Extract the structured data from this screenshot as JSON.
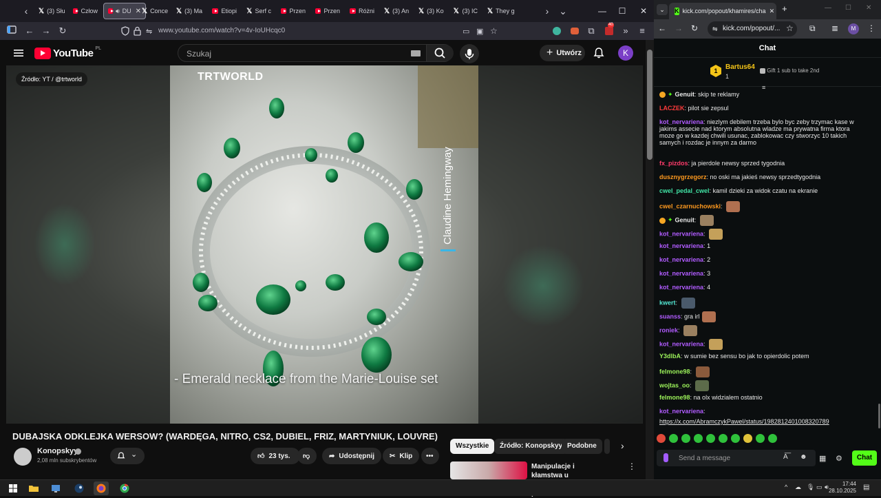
{
  "firefox": {
    "tabs": [
      {
        "label": "(3) Słu",
        "icon": "x-icon"
      },
      {
        "label": "Człow",
        "icon": "youtube-icon"
      },
      {
        "label": "DU",
        "icon": "youtube-icon",
        "active": true
      },
      {
        "label": "Conce",
        "icon": "x-icon"
      },
      {
        "label": "(3) Ma",
        "icon": "x-icon"
      },
      {
        "label": "Etiopi",
        "icon": "youtube-icon"
      },
      {
        "label": "Serf c",
        "icon": "x-icon"
      },
      {
        "label": "Przen",
        "icon": "youtube-icon"
      },
      {
        "label": "Przen",
        "icon": "youtube-icon"
      },
      {
        "label": "Różni",
        "icon": "youtube-icon"
      },
      {
        "label": "(3) An",
        "icon": "x-icon"
      },
      {
        "label": "(3) Ko",
        "icon": "x-icon"
      },
      {
        "label": "(3) IC",
        "icon": "x-icon"
      },
      {
        "label": "They g",
        "icon": "x-icon"
      }
    ],
    "url": "www.youtube.com/watch?v=4v-IoUHcqc0",
    "badge_count": "40"
  },
  "youtube": {
    "logo_text": "YouTube",
    "country": "PL",
    "search_placeholder": "Szukaj",
    "create_label": "Utwórz",
    "avatar_letter": "K",
    "video": {
      "source_badge": "Źródło: YT / @trtworld",
      "trt_logo": "TRTWORLD",
      "caption": "- Emerald necklace from the Marie-Louise set",
      "vertical_name": "Claudine Hemingway"
    },
    "title": "DUBAJSKA ODKLEJKA WERSOW? (WARDĘGA, NITRO, CS2, DUBIEL, FRIZ, MARTYNIUK, LOUVRE)",
    "channel": {
      "name": "Konopskyy",
      "subs": "2,08 mln subskrybentów"
    },
    "actions": {
      "likes": "23 tys.",
      "share": "Udostępnij",
      "clip": "Klip"
    },
    "chips": [
      "Wszystkie",
      "Źródło: Konopskyy",
      "Podobne"
    ],
    "recommendation": {
      "title": "Manipulacje i kłamstwa u Rymanowskiego, połowa"
    }
  },
  "chrome": {
    "tab_title": "kick.com/popout/khamires/cha",
    "omnibox": "kick.com/popout/...",
    "profile_letter": "M"
  },
  "chat": {
    "header": "Chat",
    "pinned": {
      "rank": "1",
      "user": "Bartus64",
      "count": "1",
      "gift_text": "Gift 1 sub to take 2nd"
    },
    "messages": [
      {
        "user": "Genuit",
        "color": "#e8e8e8",
        "text": "skip te reklamy",
        "badge": true
      },
      {
        "user": "LACZEK",
        "color": "#ff3b3b",
        "text": "pilot sie zepsul"
      },
      {
        "user": "kot_nervariena",
        "color": "#b15cff",
        "text": "niezlym debilem trzeba bylo byc zeby trzymac kase w jakims assecie nad ktorym absolutna wladze ma prywatna firma ktora moze go w kazdej chwili usunac, zablokowac czy stworzyc 10 takich samych i rozdac je innym za darmo"
      },
      {
        "user": "fx_pizdos",
        "color": "#ff3b6b",
        "text": "ja pierdole newsy sprzed tygodnia"
      },
      {
        "user": "dusznygrzegorz",
        "color": "#ff9a1f",
        "text": "no oski ma jakieś newsy sprzedtygodnia"
      },
      {
        "user": "cwel_pedal_cwel",
        "color": "#41e3a5",
        "text": "kamil dzieki za widok czatu na ekranie"
      },
      {
        "user": "cwel_czarnuchowski",
        "color": "#ff9a1f",
        "text": "",
        "emote": true
      },
      {
        "user": "Genuit",
        "color": "#e8e8e8",
        "text": "",
        "emote": true,
        "badge": true
      },
      {
        "user": "kot_nervariena",
        "color": "#b15cff",
        "text": "",
        "emote": true
      },
      {
        "user": "kot_nervariena",
        "color": "#b15cff",
        "text": "1"
      },
      {
        "user": "kot_nervariena",
        "color": "#b15cff",
        "text": "2"
      },
      {
        "user": "kot_nervariena",
        "color": "#b15cff",
        "text": "3"
      },
      {
        "user": "kot_nervariena",
        "color": "#b15cff",
        "text": "4"
      },
      {
        "user": "kwert",
        "color": "#53e8d4",
        "text": "",
        "emote": true
      },
      {
        "user": "suanss",
        "color": "#b15cff",
        "text": "gra irl",
        "emote": true
      },
      {
        "user": "roniek",
        "color": "#b15cff",
        "text": "",
        "emote": true
      },
      {
        "user": "kot_nervariena",
        "color": "#b15cff",
        "text": "",
        "emote": true
      },
      {
        "user": "Y3dlbA",
        "color": "#9cf25a",
        "text": "w sumie bez sensu bo jak to opierdolic potem"
      },
      {
        "user": "felmone98",
        "color": "#9cf25a",
        "text": "",
        "emote": true
      },
      {
        "user": "wojtas_oo",
        "color": "#9cf25a",
        "text": "",
        "emote": true
      },
      {
        "user": "felmone98",
        "color": "#9cf25a",
        "text": "na olx widzialem ostatnio"
      },
      {
        "user": "kot_nervariena",
        "color": "#b15cff",
        "text": "https://x.com/AbramczykPawel/status/1982812401008320789"
      }
    ],
    "input_placeholder": "Send a message",
    "send_label": "Chat"
  },
  "taskbar": {
    "time": "17:44",
    "date": "28.10.2025"
  }
}
